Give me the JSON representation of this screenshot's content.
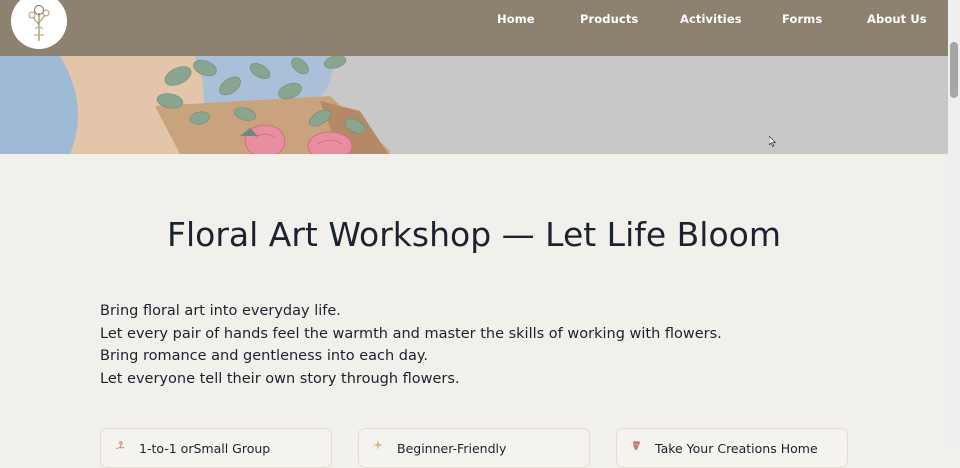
{
  "nav": {
    "logo": "flower-logo",
    "items": [
      "Home",
      "Products",
      "Activities",
      "Forms",
      "About Us"
    ]
  },
  "main": {
    "title": "Floral Art Workshop — Let Life Bloom",
    "intro": [
      "Bring floral art into everyday life.",
      "Let every pair of hands feel the warmth and master the skills of working with flowers.",
      "Bring romance and gentleness into each day.",
      "Let everyone tell their own story through flowers."
    ],
    "features": [
      {
        "icon": "hand-flower-icon",
        "label": "1-to-1 orSmall Group"
      },
      {
        "icon": "sparkle-icon",
        "label": "Beginner-Friendly"
      },
      {
        "icon": "gift-bouquet-icon",
        "label": "Take Your Creations Home"
      }
    ]
  },
  "colors": {
    "nav_bg": "#8d8170",
    "page_bg": "#f2f0eb",
    "hero_bg": "#c8c8c9",
    "text": "#1b2230"
  }
}
